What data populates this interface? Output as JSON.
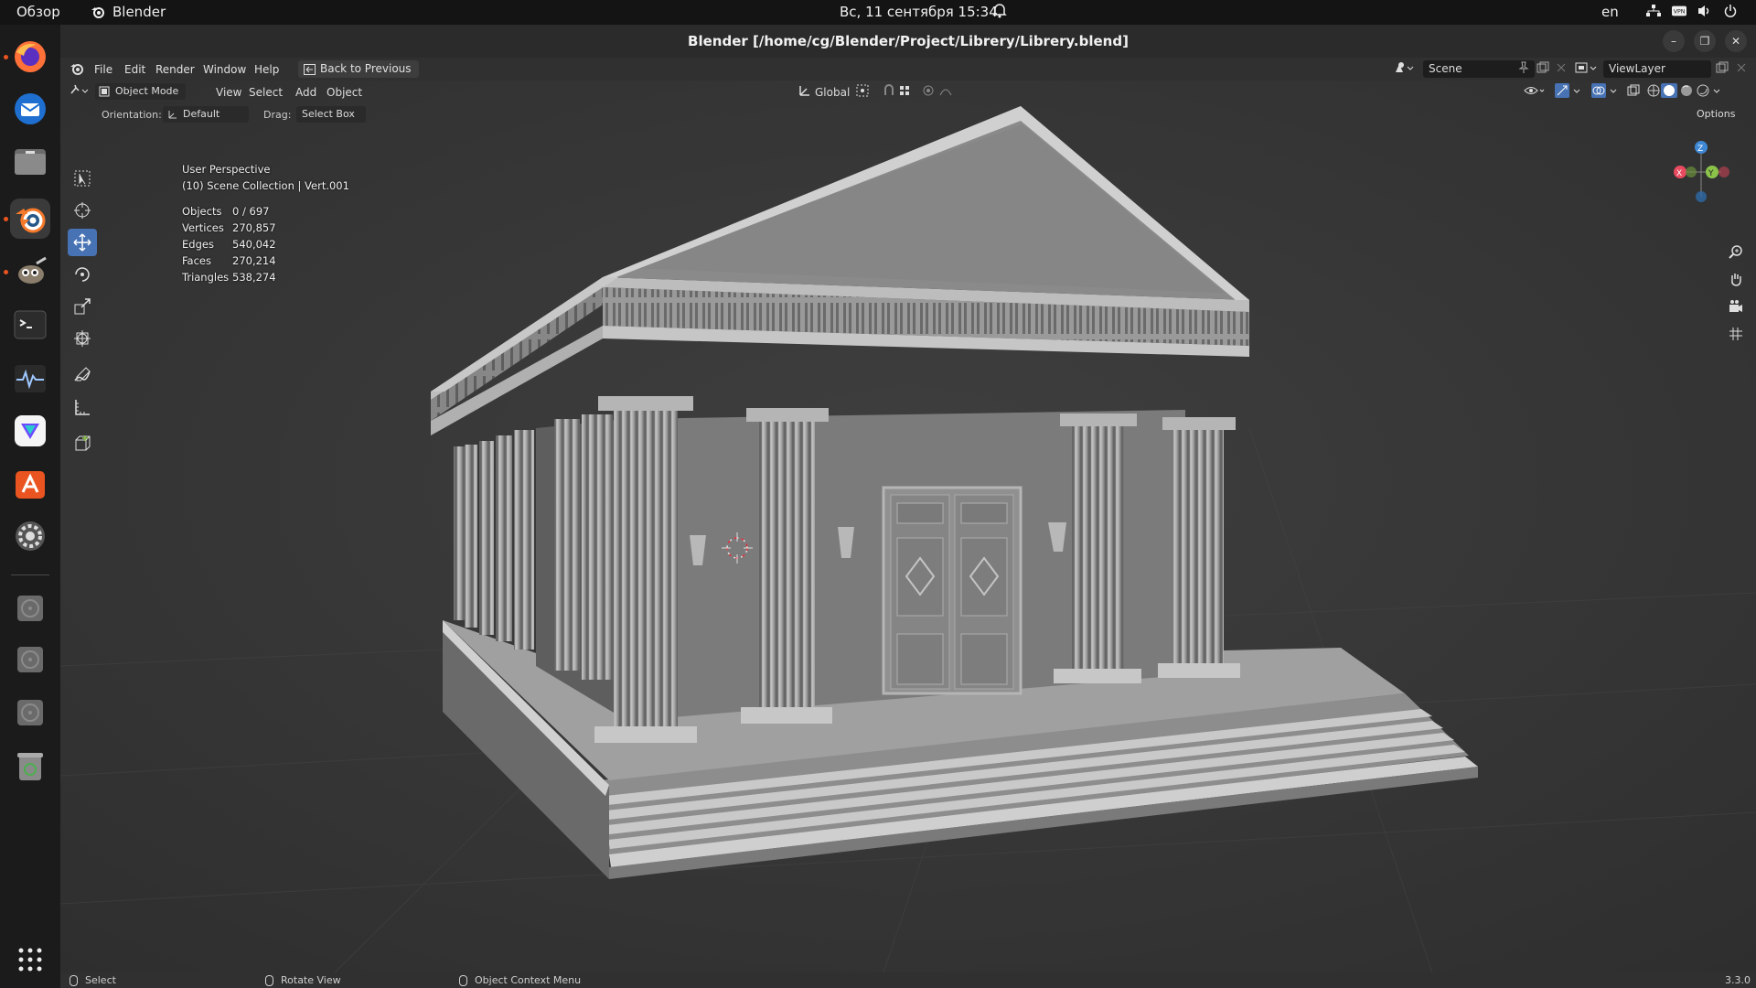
{
  "topbar": {
    "activities": "Обзор",
    "app_name": "Blender",
    "clock": "Вс, 11 сентября  15:34",
    "lang": "en"
  },
  "window": {
    "title": "Blender [/home/cg/Blender/Project/Librery/Librery.blend]"
  },
  "menubar": {
    "file": "File",
    "edit": "Edit",
    "render": "Render",
    "window": "Window",
    "help": "Help",
    "back_to_previous": "Back to Previous",
    "scene": "Scene",
    "view_layer": "ViewLayer"
  },
  "viewport_header": {
    "mode": "Object Mode",
    "view": "View",
    "select": "Select",
    "add": "Add",
    "object": "Object",
    "orientation_global": "Global",
    "options": "Options"
  },
  "tool_settings": {
    "orientation_label": "Orientation:",
    "orientation_value": "Default",
    "drag_label": "Drag:",
    "drag_value": "Select Box"
  },
  "overlay": {
    "perspective": "User Perspective",
    "collection": "(10) Scene Collection | Vert.001",
    "stats": [
      {
        "label": "Objects",
        "value": "0 / 697"
      },
      {
        "label": "Vertices",
        "value": "270,857"
      },
      {
        "label": "Edges",
        "value": "540,042"
      },
      {
        "label": "Faces",
        "value": "270,214"
      },
      {
        "label": "Triangles",
        "value": "538,274"
      }
    ]
  },
  "gizmo": {
    "x": "X",
    "y": "Y",
    "z": "Z"
  },
  "statusbar": {
    "select": "Select",
    "rotate": "Rotate View",
    "context": "Object Context Menu",
    "version": "3.3.0"
  },
  "colors": {
    "accent": "#4772b3",
    "ubuntu_orange": "#e95420",
    "axis_x": "#e84a5f",
    "axis_y": "#8bc34a",
    "axis_z": "#3f88d6"
  }
}
